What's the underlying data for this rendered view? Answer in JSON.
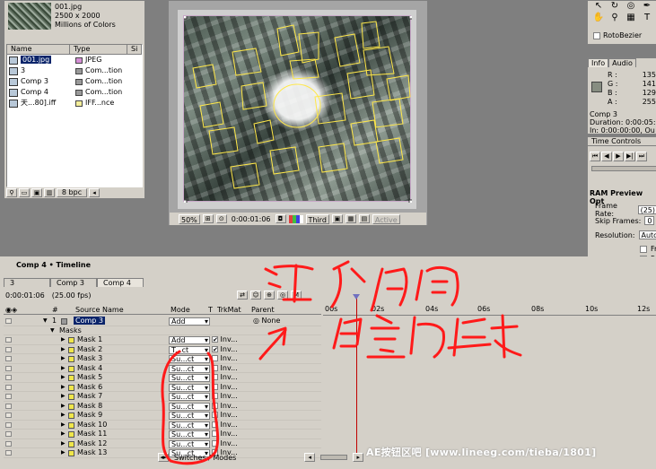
{
  "project": {
    "file_name": "001.jpg",
    "dimensions": "2500 x 2000",
    "colors": "Millions of Colors",
    "columns": [
      "Name",
      "Type",
      "Si"
    ],
    "items": [
      {
        "name": "001.jpg",
        "type": "JPEG",
        "label_color": "#d58fd5"
      },
      {
        "name": "3",
        "type": "Com...tion",
        "label_color": "#999999"
      },
      {
        "name": "Comp 3",
        "type": "Com...tion",
        "label_color": "#999999"
      },
      {
        "name": "Comp 4",
        "type": "Com...tion",
        "label_color": "#999999"
      },
      {
        "name": "天...80].iff",
        "type": "IFF...nce",
        "label_color": "#f4ee9a"
      }
    ],
    "bpc": "8 bpc"
  },
  "comp_bar": {
    "zoom": "50%",
    "timecode": "0:00:01:06",
    "resolution": "Third",
    "active_label": "Active"
  },
  "tools": {
    "icons": [
      "arrow-tool-icon",
      "rotate-tool-icon",
      "pen-tool-icon",
      "hand-tool-icon",
      "zoom-tool-icon",
      "grid-icon"
    ],
    "rotobezier": "RotoBezier"
  },
  "info": {
    "tabs": [
      "Info",
      "Audio"
    ],
    "r": "135",
    "g": "141",
    "b": "129",
    "a": "255",
    "r_label": "R :",
    "g_label": "G :",
    "b_label": "B :",
    "a_label": "A :",
    "comp_name": "Comp 3",
    "duration": "Duration: 0:00:05:",
    "in_out": "In: 0:00:00:00, Ou"
  },
  "time_controls": {
    "title": "Time Controls",
    "ram_preview": "RAM Preview Opt",
    "frame_rate_label": "Frame Rate:",
    "frame_rate": "(25)",
    "skip_label": "Skip Frames:",
    "skip": "0",
    "resolution_label": "Resolution:",
    "resolution": "Auto",
    "check1": "Fr",
    "check2": "Fu"
  },
  "timeline": {
    "title": "Comp 4 • Timeline",
    "tabs": [
      "3",
      "Comp 3",
      "Comp 4"
    ],
    "timecode": "0:00:01:06",
    "fps": "(25.00 fps)",
    "col_num": "#",
    "col_source": "Source Name",
    "col_mode": "Mode",
    "col_t": "T",
    "col_trkmat": "TrkMat",
    "col_parent": "Parent",
    "ruler": [
      "00s",
      "02s",
      "04s",
      "06s",
      "08s",
      "10s",
      "12s"
    ],
    "layer": {
      "num": "1",
      "name": "Comp 3",
      "mode": "Add",
      "parent": "None"
    },
    "masks_label": "Masks",
    "masks": [
      {
        "name": "Mask 1",
        "mode": "Add",
        "inv": "Inv",
        "checked": true
      },
      {
        "name": "Mask 2",
        "mode": "T...ct",
        "inv": "Inv",
        "checked": true
      },
      {
        "name": "Mask 3",
        "mode": "Su...ct",
        "inv": "Inv",
        "checked": false
      },
      {
        "name": "Mask 4",
        "mode": "Su...ct",
        "inv": "Inv",
        "checked": false
      },
      {
        "name": "Mask 5",
        "mode": "Su...ct",
        "inv": "Inv",
        "checked": false
      },
      {
        "name": "Mask 6",
        "mode": "Su...ct",
        "inv": "Inv",
        "checked": false
      },
      {
        "name": "Mask 7",
        "mode": "Su...ct",
        "inv": "Inv",
        "checked": false
      },
      {
        "name": "Mask 8",
        "mode": "Su...ct",
        "inv": "Inv",
        "checked": false
      },
      {
        "name": "Mask 9",
        "mode": "Su...ct",
        "inv": "Inv",
        "checked": false
      },
      {
        "name": "Mask 10",
        "mode": "Su...ct",
        "inv": "Inv",
        "checked": false
      },
      {
        "name": "Mask 11",
        "mode": "Su...ct",
        "inv": "Inv",
        "checked": false
      },
      {
        "name": "Mask 12",
        "mode": "Su...ct",
        "inv": "Inv",
        "checked": false
      },
      {
        "name": "Mask 13",
        "mode": "Su...ct",
        "inv": "Inv",
        "checked": false
      }
    ],
    "switches_modes": "Switches / Modes"
  },
  "annotation": {
    "text_line1": "注意它们",
    "text_line2": "的叠加模式",
    "color": "#ff1a1a"
  },
  "watermark": "AE按钮区吧 [www.lineeg.com/tieba/1801]"
}
